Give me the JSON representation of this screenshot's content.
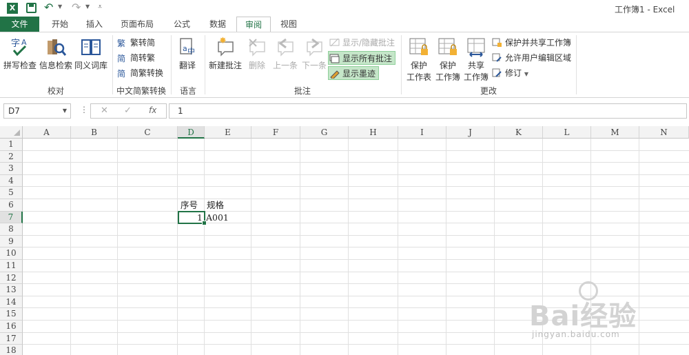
{
  "titlebar": {
    "app_icon": "X",
    "title": "工作簿1 - Excel"
  },
  "tabs": [
    "文件",
    "开始",
    "插入",
    "页面布局",
    "公式",
    "数据",
    "审阅",
    "视图"
  ],
  "active_tab": "审阅",
  "ribbon": {
    "proofing": {
      "spell": "拼写检查",
      "research": "信息检索",
      "thesaurus": "同义词库",
      "label": "校对"
    },
    "chinese": {
      "t2s": "繁转简",
      "s2t": "简转繁",
      "convert": "简繁转换",
      "label": "中文简繁转换"
    },
    "language": {
      "translate": "翻译",
      "label": "语言"
    },
    "comments": {
      "new": "新建批注",
      "delete": "删除",
      "prev": "上一条",
      "next": "下一条",
      "show_hide": "显示/隐藏批注",
      "show_all": "显示所有批注",
      "show_ink": "显示墨迹",
      "label": "批注"
    },
    "changes": {
      "protect_sheet_1": "保护",
      "protect_sheet_2": "工作表",
      "protect_wb_1": "保护",
      "protect_wb_2": "工作簿",
      "share_1": "共享",
      "share_2": "工作簿",
      "protect_share": "保护并共享工作簿",
      "allow_edit": "允许用户编辑区域",
      "track": "修订",
      "label": "更改"
    }
  },
  "formula_bar": {
    "name_box": "D7",
    "value": "1",
    "fx": "fx"
  },
  "columns": [
    "A",
    "B",
    "C",
    "D",
    "E",
    "F",
    "G",
    "H",
    "I",
    "J",
    "K",
    "L",
    "M",
    "N"
  ],
  "rows": [
    "1",
    "2",
    "3",
    "4",
    "5",
    "6",
    "7",
    "8",
    "9",
    "10",
    "11",
    "12",
    "13",
    "14",
    "15",
    "16",
    "17",
    "18"
  ],
  "selected_cell": "D7",
  "cells": {
    "D6": "序号",
    "E6": "规格",
    "D7": "1",
    "E7": "A001"
  },
  "watermark": {
    "brand": "Bai经验",
    "url": "jingyan.baidu.com"
  },
  "colors": {
    "accent": "#217346",
    "highlight": "#c5e6c9"
  }
}
